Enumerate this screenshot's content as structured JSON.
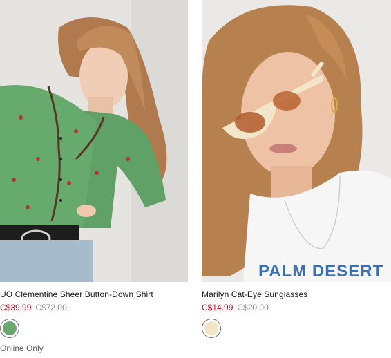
{
  "products": [
    {
      "name": "UO Clementine Sheer Button-Down Shirt",
      "sale_price": "C$39.99",
      "original_price": "C$72.00",
      "swatch_color": "#6aa86d",
      "badge": "Online Only",
      "image_icon": "model-green-shirt-photo"
    },
    {
      "name": "Marilyn Cat-Eye Sunglasses",
      "sale_price": "C$14.99",
      "original_price": "C$20.00",
      "swatch_color": "#f4e4c6",
      "image_icon": "model-sunglasses-photo",
      "shirt_print": "PALM DESERT"
    }
  ],
  "colors": {
    "sale": "#d0021b",
    "original": "#8a8a8a",
    "text": "#1a1a1a"
  }
}
